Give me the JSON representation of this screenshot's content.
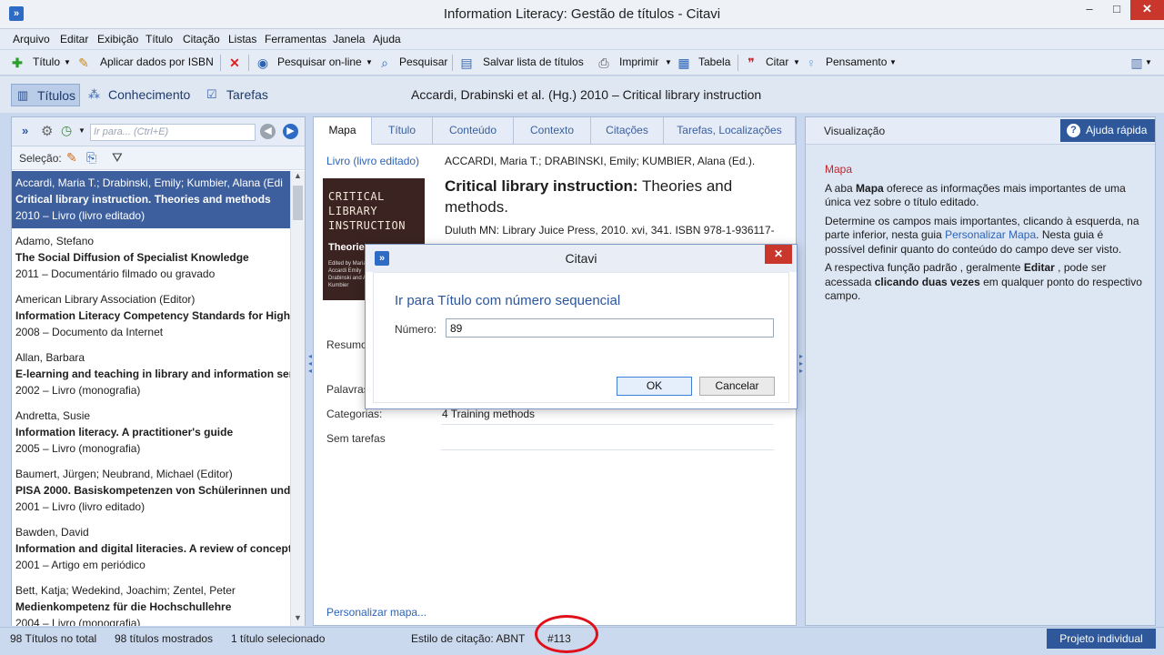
{
  "window": {
    "title": "Information Literacy: Gestão de títulos - Citavi",
    "min": "–",
    "max": "□",
    "close": "✕"
  },
  "menu": [
    "Arquivo",
    "Editar",
    "Exibição",
    "Título",
    "Citação",
    "Listas",
    "Ferramentas",
    "Janela",
    "Ajuda"
  ],
  "toolbar": {
    "title_label": "Título",
    "isbn_label": "Aplicar dados por ISBN",
    "online_search_label": "Pesquisar on-line",
    "search_label": "Pesquisar",
    "save_list_label": "Salvar lista de títulos",
    "print_label": "Imprimir",
    "table_label": "Tabela",
    "cite_label": "Citar",
    "thought_label": "Pensamento"
  },
  "nav": {
    "titles": "Títulos",
    "knowledge": "Conhecimento",
    "tasks": "Tarefas",
    "current_ref": "Accardi, Drabinski et al. (Hg.) 2010 – Critical library instruction"
  },
  "left": {
    "search_placeholder": "Ir para... (Ctrl+E)",
    "selection_label": "Seleção:",
    "items": [
      {
        "authors": "Accardi, Maria T.; Drabinski, Emily; Kumbier, Alana (Edi",
        "title": "Critical library instruction. Theories and methods",
        "meta": "2010 – Livro (livro editado)"
      },
      {
        "authors": "Adamo, Stefano",
        "title": "The Social Diffusion of Specialist Knowledge",
        "meta": "2011 – Documentário filmado ou gravado"
      },
      {
        "authors": "American Library Association (Editor)",
        "title": "Information Literacy Competency Standards for High",
        "meta": "2008 – Documento da Internet"
      },
      {
        "authors": "Allan, Barbara",
        "title": "E-learning and teaching in library and information serv",
        "meta": "2002 – Livro (monografia)"
      },
      {
        "authors": "Andretta, Susie",
        "title": "Information literacy. A practitioner's guide",
        "meta": "2005 – Livro (monografia)"
      },
      {
        "authors": "Baumert, Jürgen; Neubrand, Michael (Editor)",
        "title": "PISA 2000. Basiskompetenzen von Schülerinnen und",
        "meta": "2001 – Livro (livro editado)"
      },
      {
        "authors": "Bawden, David",
        "title": "Information and digital literacies. A review of concept",
        "meta": "2001 – Artigo em periódico"
      },
      {
        "authors": "Bett, Katja; Wedekind, Joachim; Zentel, Peter",
        "title": "Medienkompetenz für die Hochschullehre",
        "meta": "2004 – Livro (monografia)"
      }
    ]
  },
  "mid": {
    "tabs": [
      "Mapa",
      "Título",
      "Conteúdo",
      "Contexto",
      "Citações",
      "Tarefas, Localizações"
    ],
    "type_link": "Livro (livro editado)",
    "authors": "ACCARDI, Maria T.; DRABINSKI, Emily; KUMBIER, Alana (Ed.).",
    "title_bold": "Critical library instruction:",
    "title_rest": " Theories and methods.",
    "publisher": "Duluth MN: Library Juice Press, 2010. xvi, 341. ISBN 978-1-936117-01-7",
    "cover_title": "CRITICAL LIBRARY INSTRUCTION",
    "cover_sub": "Theories",
    "cover_editors": "Edited by Maria T. Accardi Emily Drabinski and Alana Kumbier",
    "abstract_label": "Resumo",
    "keywords_label": "Palavras",
    "categories_label": "Categorias:",
    "categories_value": "4 Training methods",
    "no_tasks": "Sem tarefas",
    "customize_link": "Personalizar mapa..."
  },
  "right": {
    "header": "Visualização",
    "help": "Ajuda rápida",
    "section_title": "Mapa",
    "p1_a": "A aba ",
    "p1_b": "Mapa",
    "p1_c": " oferece as informações mais importantes de uma única vez sobre o título editado.",
    "p2_a": "Determine os campos mais importantes, clicando à esquerda, na parte inferior, nesta guia ",
    "p2_link": "Personalizar Mapa",
    "p2_c": ". Nesta guia é possível definir quanto do conteúdo do campo deve ser visto.",
    "p3_a": "A respectiva função padrão , geralmente ",
    "p3_b": "Editar",
    "p3_c": " , pode ser acessada ",
    "p3_d": "clicando duas vezes",
    "p3_e": " em qualquer ponto do respectivo campo."
  },
  "status": {
    "total": "98 Títulos no total",
    "shown": "98 títulos mostrados",
    "selected": "1 título selecionado",
    "style": "Estilo de citação: ABNT",
    "number": "#113",
    "project": "Projeto individual"
  },
  "dialog": {
    "title": "Citavi",
    "heading": "Ir para Título com número sequencial",
    "label": "Número:",
    "value": "89",
    "ok": "OK",
    "cancel": "Cancelar",
    "close": "✕"
  },
  "colors": {
    "accent": "#2e5899",
    "selection": "#3d5f9e",
    "highlight_ring": "#e0101a"
  }
}
